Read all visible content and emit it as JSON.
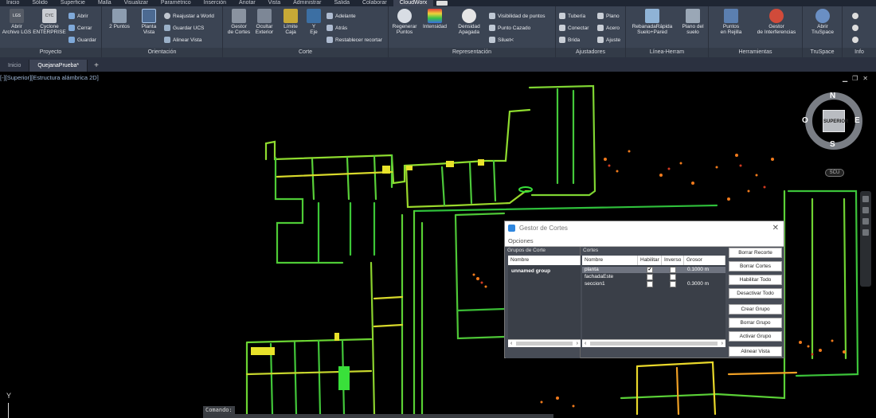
{
  "menu": {
    "items": [
      "Inicio",
      "Sólido",
      "Superficie",
      "Malla",
      "Visualizar",
      "Paramétrico",
      "Inserción",
      "Anotar",
      "Vista",
      "Administrar",
      "Salida",
      "Colaborar",
      "CloudWorx"
    ],
    "active": "CloudWorx"
  },
  "ribbon": {
    "proyecto": {
      "title": "Proyecto",
      "abrir_lgs": "Abrir\nArchivo LGS",
      "cyclone": "Cyclone\nENTERPRISE",
      "abrir": "Abrir",
      "cerrar": "Cerrar",
      "guardar": "Guardar",
      "lgs_badge": "LGS",
      "cyc_badge": "CYC"
    },
    "orientacion": {
      "title": "Orientación",
      "dos_puntos": "2 Puntos",
      "planta_vista": "Planta\nVista",
      "reajustar": "Reajustar a World",
      "guardar_ucs": "Guardar UCS",
      "alinear": "Alinear Vista"
    },
    "corte": {
      "title": "Corte",
      "gestor": "Gestor\nde Cortes",
      "ocultar": "Ocultar\nExterior",
      "limite": "Límite\nCaja",
      "eje": "Y\nEje",
      "adelante": "Adelante",
      "atras": "Atrás",
      "restablecer": "Restablecer recortar"
    },
    "representacion": {
      "title": "Representación",
      "regenerar": "Regenerar\nPuntos",
      "intensidad": "Intensidad",
      "densidad": "Densidad\nApagada",
      "visibilidad": "Visibilidad de puntos",
      "punto_cazado": "Punto Cazado",
      "siluet": "Siluet<"
    },
    "ajustadores": {
      "title": "Ajustadores",
      "tuberia": "Tubería",
      "conectar": "Conectar",
      "brida": "Brida",
      "plano": "Plano",
      "acero": "Acero",
      "ajuste": "Ajuste"
    },
    "linea": {
      "title": "Línea-Herram",
      "rebanada": "RebanadaRápida\nSuelo+Pared",
      "plano_suelo": "Plano del\nsuelo"
    },
    "herramientas": {
      "title": "Herramientas",
      "puntos_rejilla": "Puntos\nen Rejilla",
      "gestor_interf": "Gestor\nde Interferencias"
    },
    "truspace": {
      "title": "TruSpace",
      "abrir": "Abrir\nTruSpace"
    },
    "info": {
      "title": "Info"
    }
  },
  "tabs": [
    "Inicio",
    "QuejanaPrueba*"
  ],
  "viewport": {
    "label": "[-][Superior][Estructura alámbrica 2D]",
    "viewcube": {
      "face": "SUPERIOR",
      "n": "N",
      "s": "S",
      "e": "E",
      "o": "O",
      "scu": "SCU"
    },
    "ucs_y": "Y",
    "command_label": "Comando:"
  },
  "dialog": {
    "title": "Gestor de Cortes",
    "menu": "Opciones",
    "groups": {
      "header": "Grupos de Corte",
      "col": "Nombre",
      "items": [
        "unnamed group"
      ]
    },
    "cuts": {
      "header": "Cortes",
      "cols": [
        "Nombre",
        "Habilitar",
        "Inverso",
        "Grosor"
      ],
      "rows": [
        {
          "name": "planta",
          "enabled": true,
          "inverse": false,
          "thickness": "0.1000 m"
        },
        {
          "name": "fachadaEste",
          "enabled": false,
          "inverse": false,
          "thickness": ""
        },
        {
          "name": "seccion1",
          "enabled": false,
          "inverse": false,
          "thickness": "0.3000 m"
        }
      ]
    },
    "buttons": [
      "Borrar Recorte",
      "Borrar Cortes",
      "Habilitar Todo",
      "Desactivar Todo",
      "Crear Grupo",
      "Borrar Grupo",
      "Activar Grupo",
      "Alinear Vista"
    ]
  },
  "colors": {
    "accent": "#2e86de",
    "point_green": "#39e03a",
    "point_yellow": "#e8e22a",
    "point_orange": "#f07a1c",
    "point_red": "#d13a20"
  }
}
